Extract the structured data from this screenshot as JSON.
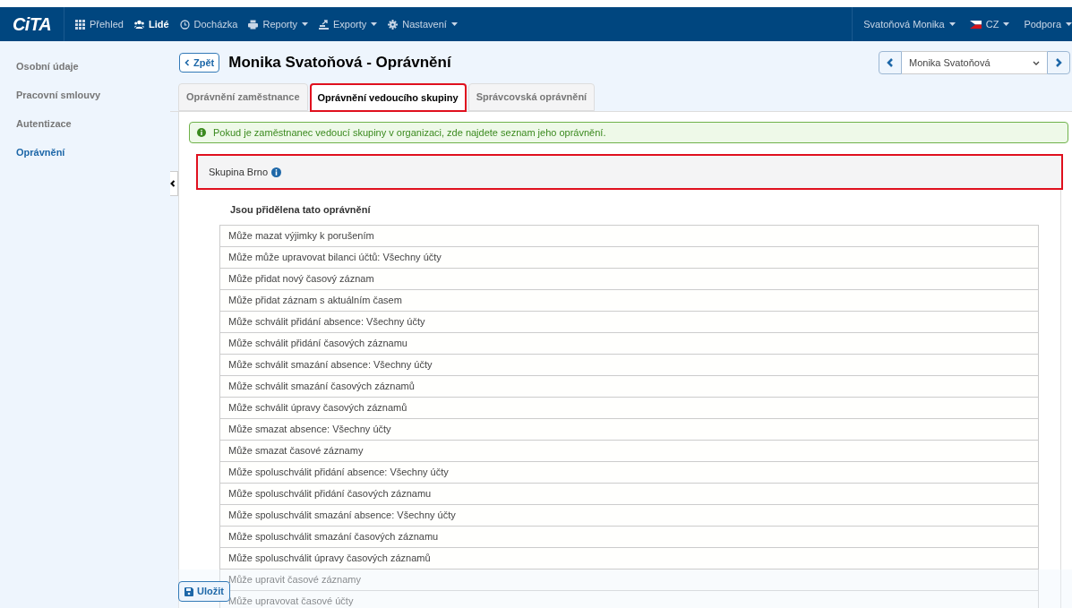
{
  "navbar": {
    "logo": "CiTA",
    "items": [
      {
        "label": "Přehled",
        "selected": false,
        "dropdown": false
      },
      {
        "label": "Lidé",
        "selected": true,
        "dropdown": false
      },
      {
        "label": "Docházka",
        "selected": false,
        "dropdown": false
      },
      {
        "label": "Reporty",
        "selected": false,
        "dropdown": true
      },
      {
        "label": "Exporty",
        "selected": false,
        "dropdown": true
      },
      {
        "label": "Nastavení",
        "selected": false,
        "dropdown": true
      }
    ],
    "right": [
      {
        "label": "Svatoňová Monika",
        "kind": "user"
      },
      {
        "label": "CZ",
        "kind": "flag"
      },
      {
        "label": "Podpora",
        "kind": "plain"
      }
    ]
  },
  "sidebar": {
    "items": [
      {
        "label": "Osobní údaje",
        "selected": false
      },
      {
        "label": "Pracovní smlouvy",
        "selected": false
      },
      {
        "label": "Autentizace",
        "selected": false
      },
      {
        "label": "Oprávnění",
        "selected": true
      }
    ]
  },
  "header": {
    "back": "Zpět",
    "title": "Monika Svatoňová - Oprávnění",
    "employee_select": "Monika Svatoňová"
  },
  "tabs": [
    {
      "label": "Oprávnění zaměstnance",
      "selected": false,
      "highlighted": false
    },
    {
      "label": "Oprávnění vedoucího skupiny",
      "selected": true,
      "highlighted": true
    },
    {
      "label": "Správcovská oprávnění",
      "selected": false,
      "highlighted": false
    }
  ],
  "alert": "Pokud je zaměstnanec vedoucí skupiny v organizaci, zde najdete seznam jeho oprávnění.",
  "group": {
    "name": "Skupina Brno",
    "highlighted": true,
    "heading": "Jsou přidělena tato oprávnění",
    "permissions": [
      "Může mazat výjimky k porušením",
      "Může může upravovat bilanci účtů: Všechny účty",
      "Může přidat nový časový záznam",
      "Může přidat záznam s aktuálním časem",
      "Může schválit přidání absence: Všechny účty",
      "Může schválit přidání časových záznamu",
      "Může schválit smazání absence: Všechny účty",
      "Může schválit smazání časových záznamů",
      "Může schválit úpravy časových záznamů",
      "Může smazat absence: Všechny účty",
      "Může smazat časové záznamy",
      "Může spoluschválit přidání absence: Všechny účty",
      "Může spoluschválit přidání časových záznamu",
      "Může spoluschválit smazání absence: Všechny účty",
      "Může spoluschválit smazání časových záznamu",
      "Může spoluschválit úpravy časových záznamů",
      "Může upravit časové záznamy",
      "Může upravovat časové účty"
    ]
  },
  "save": "Uložit"
}
